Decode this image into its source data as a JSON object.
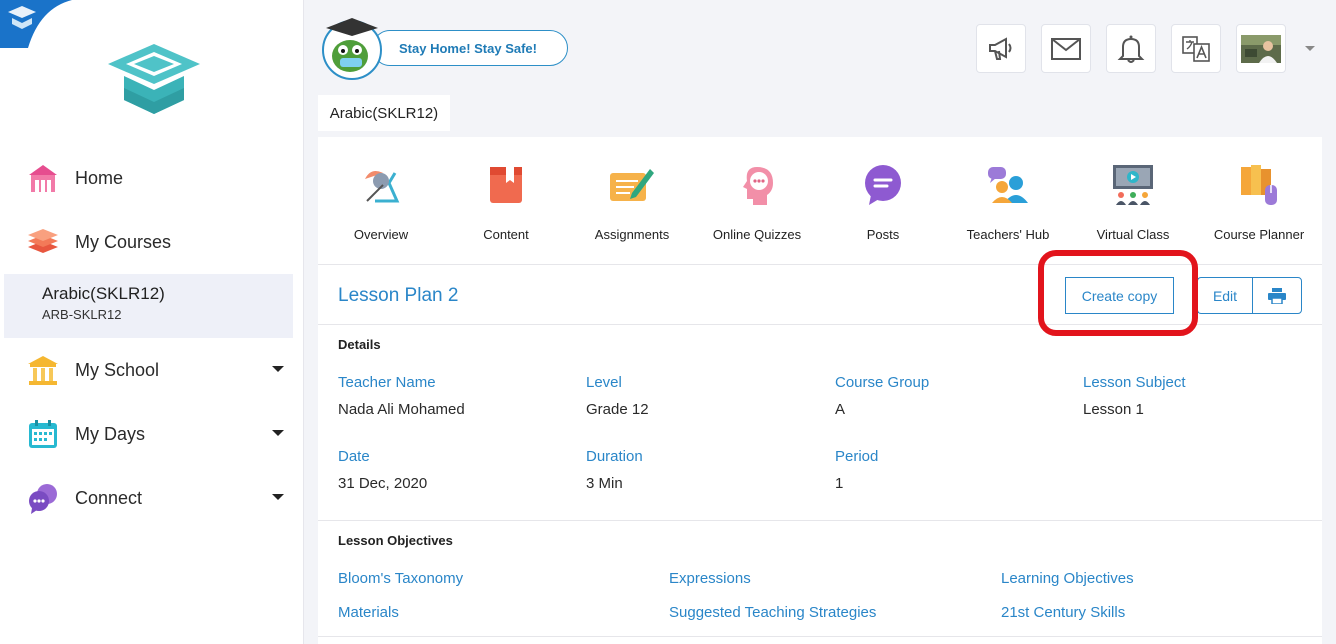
{
  "sidebar": {
    "items": [
      {
        "label": "Home"
      },
      {
        "label": "My Courses"
      },
      {
        "label": "My School"
      },
      {
        "label": "My Days"
      },
      {
        "label": "Connect"
      }
    ],
    "active_course": {
      "title": "Arabic(SKLR12)",
      "code": "ARB-SKLR12"
    }
  },
  "topbar": {
    "banner": "Stay Home! Stay Safe!",
    "icons": [
      "megaphone-icon",
      "mail-icon",
      "bell-icon",
      "translate-icon",
      "avatar"
    ]
  },
  "course_tab": "Arabic(SKLR12)",
  "tools": [
    {
      "label": "Overview"
    },
    {
      "label": "Content"
    },
    {
      "label": "Assignments"
    },
    {
      "label": "Online Quizzes"
    },
    {
      "label": "Posts"
    },
    {
      "label": "Teachers' Hub"
    },
    {
      "label": "Virtual Class"
    },
    {
      "label": "Course Planner"
    }
  ],
  "plan": {
    "title": "Lesson Plan 2",
    "create_copy": "Create copy",
    "edit": "Edit"
  },
  "details": {
    "heading": "Details",
    "fields": [
      {
        "label": "Teacher Name",
        "value": "Nada Ali Mohamed"
      },
      {
        "label": "Level",
        "value": "Grade 12"
      },
      {
        "label": "Course Group",
        "value": "A"
      },
      {
        "label": "Lesson Subject",
        "value": "Lesson 1"
      },
      {
        "label": "Date",
        "value": "31 Dec, 2020"
      },
      {
        "label": "Duration",
        "value": "3 Min"
      },
      {
        "label": "Period",
        "value": "1"
      }
    ]
  },
  "objectives": {
    "heading": "Lesson Objectives",
    "links": [
      "Bloom's Taxonomy",
      "Expressions",
      "Learning Objectives",
      "Materials",
      "Suggested Teaching Strategies",
      "21st Century Skills"
    ]
  },
  "colors": {
    "accent": "#2a86c8",
    "highlight": "#e2141c"
  }
}
